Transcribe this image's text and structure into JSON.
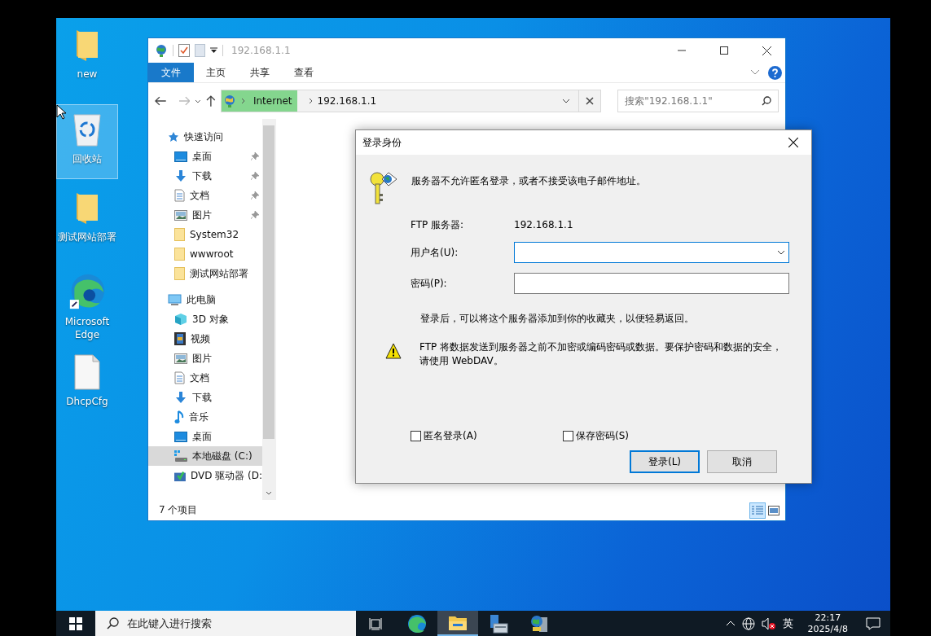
{
  "desktop_icons": [
    {
      "label": "new",
      "kind": "folder",
      "selected": false
    },
    {
      "label": "回收站",
      "kind": "recycle",
      "selected": true
    },
    {
      "label": "测试网站部署",
      "kind": "folder",
      "selected": false
    },
    {
      "label": "Microsoft Edge",
      "kind": "edge",
      "selected": false
    },
    {
      "label": "DhcpCfg",
      "kind": "file",
      "selected": false
    }
  ],
  "explorer": {
    "title": "192.168.1.1",
    "ribbon_tabs": [
      {
        "label": "文件",
        "kind": "file"
      },
      {
        "label": "主页",
        "kind": "tab"
      },
      {
        "label": "共享",
        "kind": "tab"
      },
      {
        "label": "查看",
        "kind": "tab"
      }
    ],
    "breadcrumbs": [
      "Internet",
      "192.168.1.1"
    ],
    "search": {
      "placeholder": "搜索\"192.168.1.1\""
    },
    "nav": [
      {
        "label": "快速访问",
        "kind": "star",
        "selected": false,
        "children": [
          {
            "label": "桌面",
            "kind": "desktop",
            "pinned": true,
            "selected": false
          },
          {
            "label": "下载",
            "kind": "download",
            "pinned": true,
            "selected": false
          },
          {
            "label": "文档",
            "kind": "document",
            "pinned": true,
            "selected": false
          },
          {
            "label": "图片",
            "kind": "pictures",
            "pinned": true,
            "selected": false
          },
          {
            "label": "System32",
            "kind": "folder",
            "pinned": false,
            "selected": false
          },
          {
            "label": "wwwroot",
            "kind": "folder",
            "pinned": false,
            "selected": false
          },
          {
            "label": "测试网站部署",
            "kind": "folder",
            "pinned": false,
            "selected": false
          }
        ]
      },
      {
        "label": "此电脑",
        "kind": "computer",
        "selected": false,
        "children": [
          {
            "label": "3D 对象",
            "kind": "cube",
            "pinned": false,
            "selected": false
          },
          {
            "label": "视频",
            "kind": "video",
            "pinned": false,
            "selected": false
          },
          {
            "label": "图片",
            "kind": "pictures",
            "pinned": false,
            "selected": false
          },
          {
            "label": "文档",
            "kind": "document",
            "pinned": false,
            "selected": false
          },
          {
            "label": "下载",
            "kind": "download",
            "pinned": false,
            "selected": false
          },
          {
            "label": "音乐",
            "kind": "music",
            "pinned": false,
            "selected": false
          },
          {
            "label": "桌面",
            "kind": "desktop",
            "pinned": false,
            "selected": false
          },
          {
            "label": "本地磁盘 (C:)",
            "kind": "drive",
            "pinned": false,
            "selected": true
          },
          {
            "label": "DVD 驱动器 (D:",
            "kind": "dvd",
            "pinned": false,
            "selected": false
          }
        ]
      }
    ],
    "status": "7 个项目",
    "views": [
      {
        "kind": "details",
        "selected": true
      },
      {
        "kind": "tiles",
        "selected": false
      }
    ]
  },
  "dialog": {
    "title": "登录身份",
    "message": "服务器不允许匿名登录，或者不接受该电子邮件地址。",
    "server_label": "FTP 服务器:",
    "server_value": "192.168.1.1",
    "username": {
      "label": "用户名(U):",
      "focused": true
    },
    "password": {
      "label": "密码(P):",
      "focused": false
    },
    "info": "登录后，可以将这个服务器添加到你的收藏夹，以便轻易返回。",
    "warning": "FTP 将数据发送到服务器之前不加密或编码密码或数据。要保护密码和数据的安全，请使用 WebDAV。",
    "checkboxes": [
      {
        "label": "匿名登录(A)",
        "checked": false
      },
      {
        "label": "保存密码(S)",
        "checked": false
      }
    ],
    "buttons": [
      {
        "label": "登录(L)",
        "default": true
      },
      {
        "label": "取消",
        "default": false
      }
    ]
  },
  "taskbar": {
    "search_placeholder": "在此键入进行搜索",
    "apps": [
      {
        "kind": "taskview",
        "active": false
      },
      {
        "kind": "edge",
        "active": false
      },
      {
        "kind": "explorer",
        "active": true
      },
      {
        "kind": "server",
        "active": false
      },
      {
        "kind": "network",
        "active": false
      }
    ],
    "volume_muted": true,
    "language": "英",
    "time": "22:17",
    "date": "2025/4/8"
  }
}
